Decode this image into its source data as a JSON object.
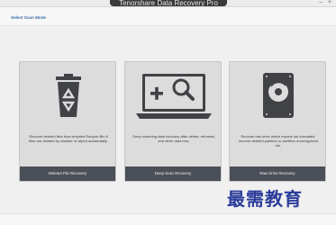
{
  "window": {
    "title": "Tenorshare Data Recovery Pro"
  },
  "header": {
    "mode_label": "Select Scan Mode"
  },
  "modes": [
    {
      "description": "Recover deleted files from emptied Recycle Bin if files are deleted by mistake or wiped accidentally.",
      "button_label": "Deleted File Recovery",
      "icon": "recycle-bin-icon"
    },
    {
      "description": "Deep scanning data recovery after delete, reformat, and other data loss.",
      "button_label": "Deep Scan Recovery",
      "icon": "deep-scan-monitor-icon"
    },
    {
      "description": "Recover raw drive which reports not formatted, recover deleted partition or partition unrecognized etc.",
      "button_label": "Raw Drive Recovery",
      "icon": "raw-drive-icon"
    }
  ],
  "watermark": {
    "text": "最需教育"
  },
  "colors": {
    "button_bg": "#4b4f58",
    "panel_bg": "#dcdcdc",
    "icon": "#404246",
    "mode_label": "#3c6fa6",
    "watermark": "#2a3b9a"
  }
}
